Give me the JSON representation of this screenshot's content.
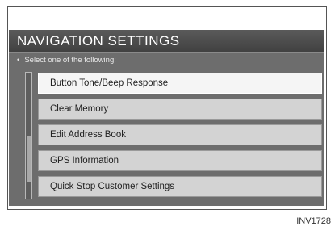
{
  "screen": {
    "title": "NAVIGATION SETTINGS",
    "prompt": "Select one of the following:",
    "menu_items": [
      {
        "label": "Button Tone/Beep Response",
        "selected": true
      },
      {
        "label": "Clear Memory",
        "selected": false
      },
      {
        "label": "Edit Address Book",
        "selected": false
      },
      {
        "label": "GPS Information",
        "selected": false
      },
      {
        "label": "Quick Stop Customer Settings",
        "selected": false
      }
    ]
  },
  "figure_code": "INV1728"
}
